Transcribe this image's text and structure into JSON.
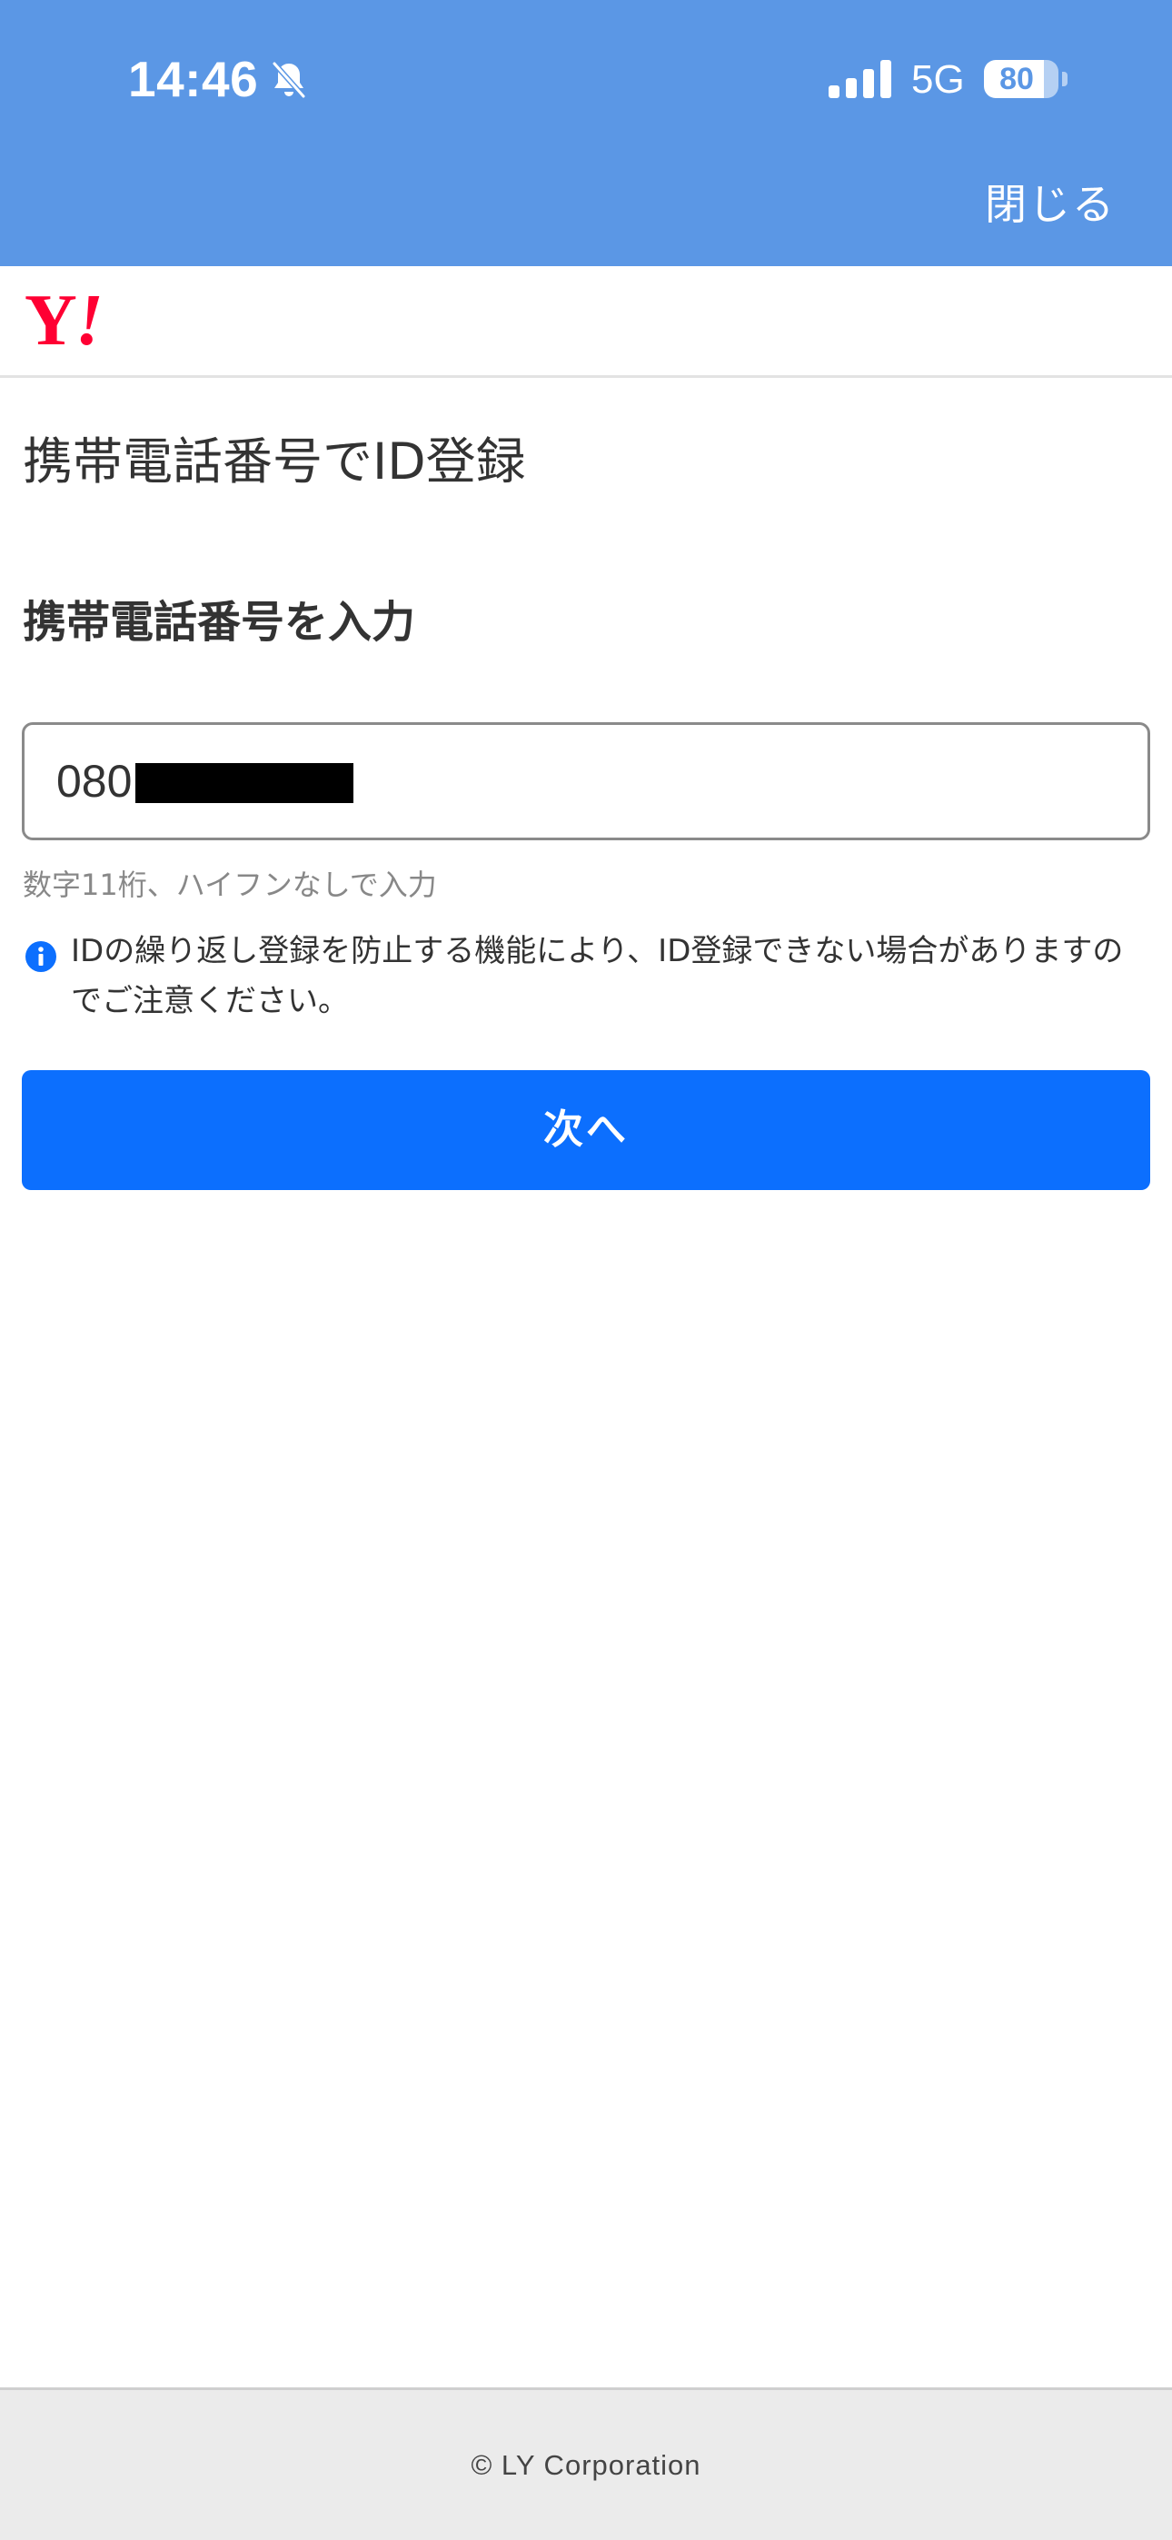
{
  "status_bar": {
    "time": "14:46",
    "network": "5G",
    "battery_level": "80",
    "battery_fraction": 0.8,
    "icons": [
      "bell-slash-icon",
      "cellular-signal-icon",
      "battery-icon"
    ]
  },
  "top_bar": {
    "close_label": "閉じる",
    "background_color": "#5b97e5"
  },
  "logo": {
    "text": "Y",
    "bang": "!",
    "color": "#ff0033"
  },
  "main": {
    "title": "携帯電話番号でID登録",
    "section_heading": "携帯電話番号を入力",
    "phone_input": {
      "value": "080"
    },
    "hint": "数字11桁、ハイフンなしで入力",
    "notice": {
      "icon": "info-icon",
      "text": "IDの繰り返し登録を防止する機能により、ID登録できない場合がありますのでご注意ください。"
    },
    "next_button_label": "次へ",
    "accent_color": "#0c6ffe"
  },
  "footer": {
    "text": "© LY Corporation"
  }
}
